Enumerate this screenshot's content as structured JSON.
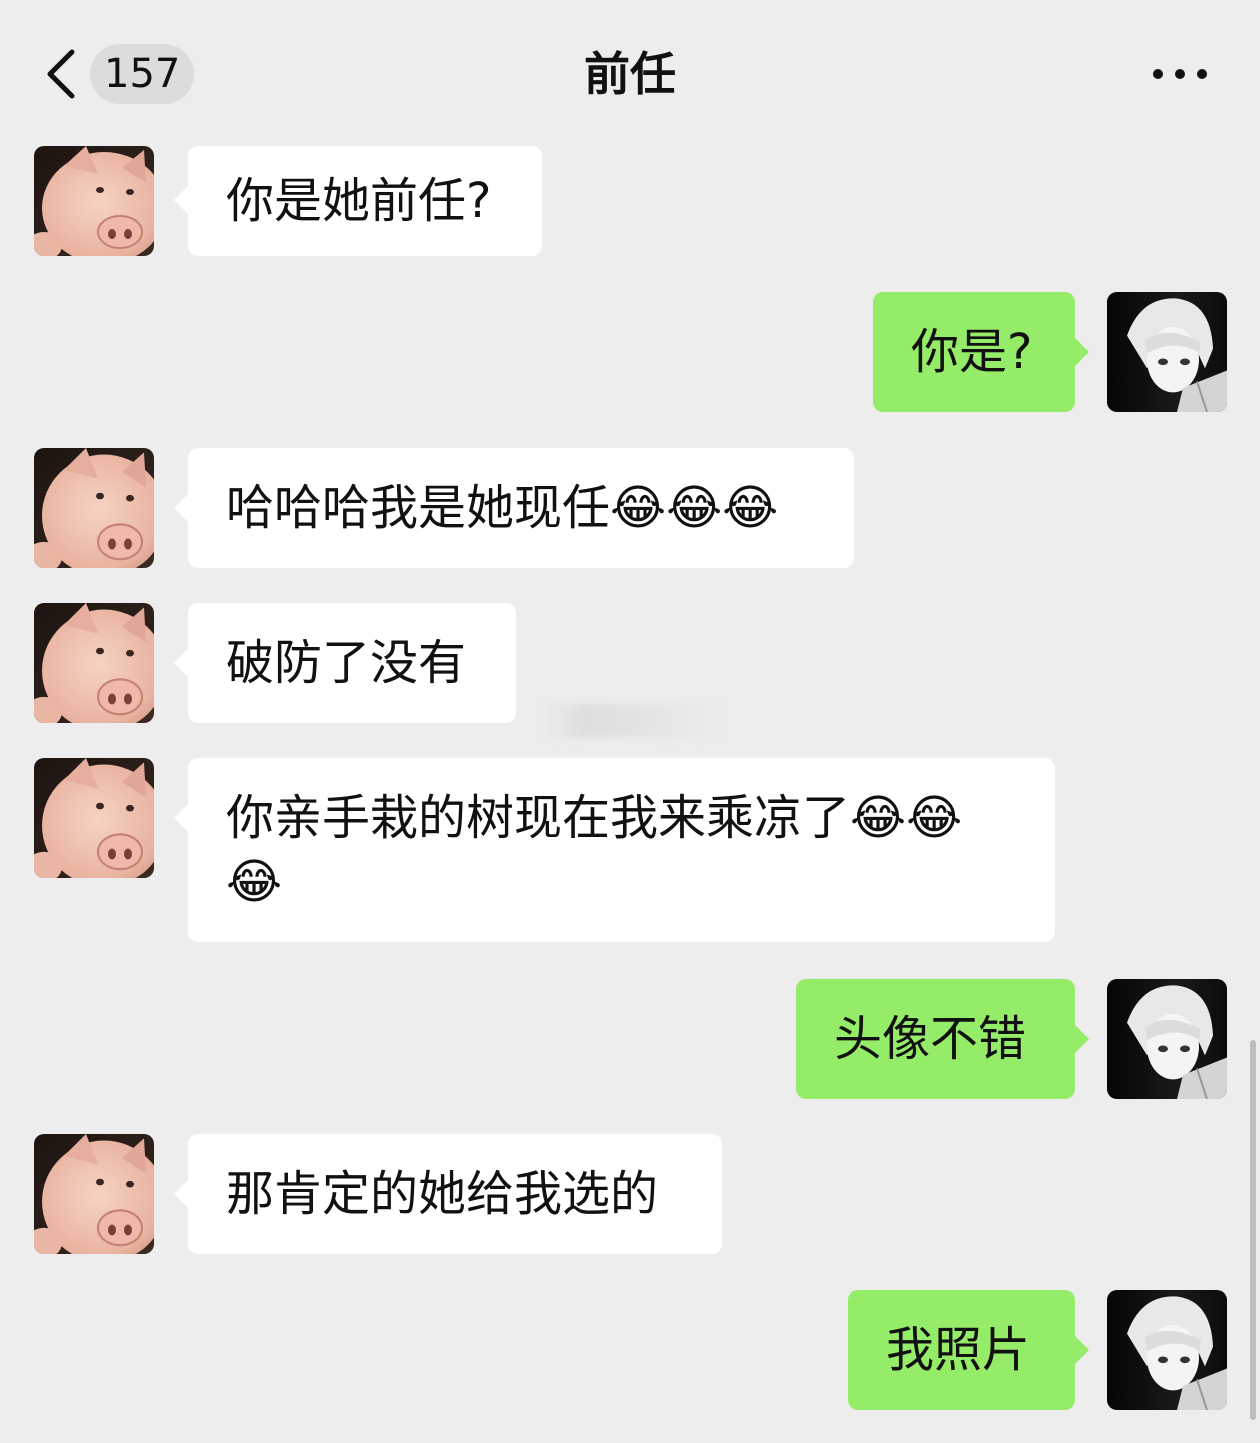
{
  "header": {
    "unread_count": "157",
    "title": "前任",
    "back_icon": "chevron-left-icon",
    "more_icon": "more-dots-icon"
  },
  "messages": [
    {
      "side": "left",
      "avatar": "pig-avatar",
      "text": "你是她前任?"
    },
    {
      "side": "right",
      "avatar": "anime-avatar",
      "text": "你是?"
    },
    {
      "side": "left",
      "avatar": "pig-avatar",
      "text": "哈哈哈我是她现任😂😂😂"
    },
    {
      "side": "left",
      "avatar": "pig-avatar",
      "text": "破防了没有"
    },
    {
      "side": "left",
      "avatar": "pig-avatar",
      "text": "你亲手栽的树现在我来乘凉了😂😂😂"
    },
    {
      "side": "right",
      "avatar": "anime-avatar",
      "text": "头像不错"
    },
    {
      "side": "left",
      "avatar": "pig-avatar",
      "text": "那肯定的她给我选的"
    },
    {
      "side": "right",
      "avatar": "anime-avatar",
      "text": "我照片"
    }
  ],
  "colors": {
    "background": "#ededed",
    "incoming_bubble": "#ffffff",
    "outgoing_bubble": "#95ec69"
  }
}
